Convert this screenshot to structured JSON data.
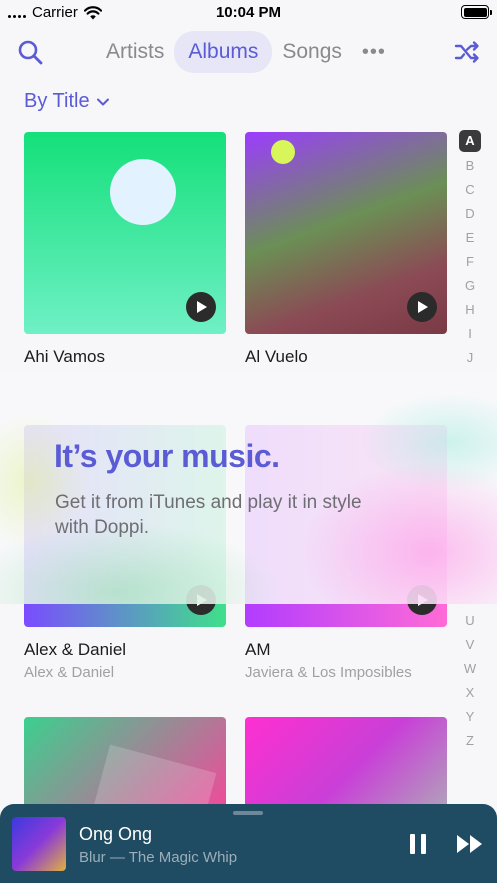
{
  "status_bar": {
    "carrier": "Carrier",
    "time": "10:04 PM"
  },
  "nav": {
    "tabs": [
      {
        "label": "Artists",
        "active": false
      },
      {
        "label": "Albums",
        "active": true
      },
      {
        "label": "Songs",
        "active": false
      }
    ],
    "more_label": "•••",
    "accent_color": "#5b5bd6"
  },
  "sort": {
    "label": "By Title"
  },
  "albums": [
    {
      "title": "Ahi Vamos",
      "artist": ""
    },
    {
      "title": "Al Vuelo",
      "artist": ""
    },
    {
      "title": "Alex & Daniel",
      "artist": "Alex & Daniel"
    },
    {
      "title": "AM",
      "artist": "Javiera & Los Imposibles"
    },
    {
      "title": "",
      "artist": ""
    },
    {
      "title": "",
      "artist": ""
    }
  ],
  "alpha_index": {
    "top": [
      "A",
      "B",
      "C",
      "D",
      "E",
      "F",
      "G",
      "H",
      "I",
      "J"
    ],
    "bottom": [
      "U",
      "V",
      "W",
      "X",
      "Y",
      "Z"
    ],
    "active": "A"
  },
  "promo": {
    "title": "It’s your music.",
    "body": "Get it from iTunes and play it in style with Doppi."
  },
  "now_playing": {
    "title": "Ong Ong",
    "subtitle": "Blur — The Magic Whip",
    "background_color": "#1f4b63"
  }
}
